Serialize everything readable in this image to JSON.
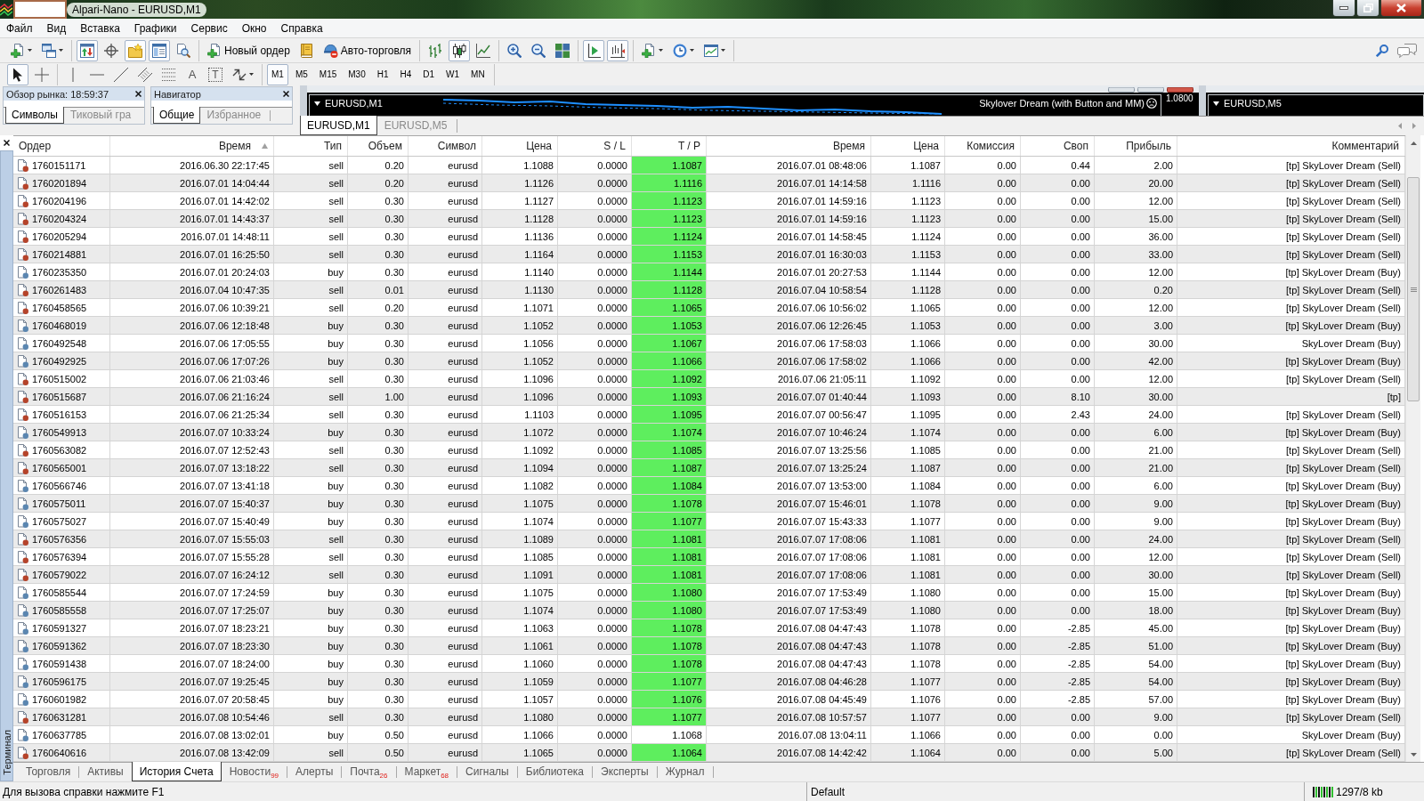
{
  "window": {
    "title": "Alpari-Nano - EURUSD,M1"
  },
  "menu": [
    "Файл",
    "Вид",
    "Вставка",
    "Графики",
    "Сервис",
    "Окно",
    "Справка"
  ],
  "main_toolbar": [
    [
      {
        "pressed": false
      },
      {
        "pressed": false
      }
    ],
    [
      {
        "pressed": true
      },
      {
        "pressed": false
      },
      {
        "pressed": true
      },
      {
        "pressed": true
      },
      {
        "pressed": false
      }
    ],
    [
      {
        "label": "Новый ордер",
        "pressed": false
      },
      {
        "pressed": false
      },
      {
        "label": "Авто-торговля",
        "pressed": false
      }
    ],
    [
      {
        "pressed": false
      },
      {
        "pressed": true
      },
      {
        "pressed": false
      }
    ],
    [
      {
        "pressed": false
      },
      {
        "pressed": false
      },
      {
        "pressed": false
      }
    ],
    [
      {
        "pressed": true
      },
      {
        "pressed": true
      }
    ],
    [
      {
        "pressed": false
      },
      {
        "pressed": false
      },
      {
        "pressed": false
      }
    ]
  ],
  "drawing_toolbar": [
    [
      {
        "pressed": true
      },
      {
        "pressed": false
      }
    ],
    [
      {
        "pressed": false
      },
      {
        "pressed": false
      },
      {
        "pressed": false
      },
      {
        "pressed": false
      },
      {
        "pressed": false
      },
      {
        "label": "A",
        "pressed": false
      },
      {
        "label": "T",
        "pressed": false
      },
      {
        "pressed": false
      }
    ]
  ],
  "timeframes": [
    {
      "label": "M1",
      "selected": true
    },
    {
      "label": "M5",
      "selected": false
    },
    {
      "label": "M15",
      "selected": false
    },
    {
      "label": "M30",
      "selected": false
    },
    {
      "label": "H1",
      "selected": false
    },
    {
      "label": "H4",
      "selected": false
    },
    {
      "label": "D1",
      "selected": false
    },
    {
      "label": "W1",
      "selected": false
    },
    {
      "label": "MN",
      "selected": false
    }
  ],
  "market_watch": {
    "title": "Обзор рынка: 18:59:37",
    "tabs": [
      {
        "label": "Символы",
        "selected": true
      },
      {
        "label": "Тиковый гра",
        "selected": false
      }
    ]
  },
  "navigator": {
    "title": "Навигатор",
    "tabs": [
      {
        "label": "Общие",
        "selected": true
      },
      {
        "label": "Избранное",
        "selected": false
      }
    ]
  },
  "charts": [
    {
      "title": "EURUSD,M1",
      "expert": "Skylover Dream (with Button and MM)",
      "price_label": "1.0800"
    },
    {
      "title": "EURUSD,M5"
    }
  ],
  "chart_tabs": [
    {
      "label": "EURUSD,M1",
      "selected": true
    },
    {
      "label": "EURUSD,M5",
      "selected": false
    }
  ],
  "terminal": {
    "label": "Терминал",
    "columns": [
      {
        "title": "Ордер",
        "sorted": false
      },
      {
        "title": "Время",
        "sorted": true
      },
      {
        "title": "Тип",
        "sorted": false
      },
      {
        "title": "Объем",
        "sorted": false
      },
      {
        "title": "Символ",
        "sorted": false
      },
      {
        "title": "Цена",
        "sorted": false
      },
      {
        "title": "S / L",
        "sorted": false
      },
      {
        "title": "T / P",
        "sorted": false
      },
      {
        "title": "Время",
        "sorted": false
      },
      {
        "title": "Цена",
        "sorted": false
      },
      {
        "title": "Комиссия",
        "sorted": false
      },
      {
        "title": "Своп",
        "sorted": false
      },
      {
        "title": "Прибыль",
        "sorted": false
      },
      {
        "title": "Комментарий",
        "sorted": false
      }
    ],
    "rows": [
      {
        "kind": "sell",
        "tp_hit": true,
        "cells": [
          "1760151171",
          "2016.06.30 22:17:45",
          "sell",
          "0.20",
          "eurusd",
          "1.1088",
          "0.0000",
          "1.1087",
          "2016.07.01 08:48:06",
          "1.1087",
          "0.00",
          "0.44",
          "2.00",
          "[tp] SkyLover Dream (Sell)"
        ]
      },
      {
        "kind": "sell",
        "tp_hit": true,
        "cells": [
          "1760201894",
          "2016.07.01 14:04:44",
          "sell",
          "0.20",
          "eurusd",
          "1.1126",
          "0.0000",
          "1.1116",
          "2016.07.01 14:14:58",
          "1.1116",
          "0.00",
          "0.00",
          "20.00",
          "[tp] SkyLover Dream (Sell)"
        ]
      },
      {
        "kind": "sell",
        "tp_hit": true,
        "cells": [
          "1760204196",
          "2016.07.01 14:42:02",
          "sell",
          "0.30",
          "eurusd",
          "1.1127",
          "0.0000",
          "1.1123",
          "2016.07.01 14:59:16",
          "1.1123",
          "0.00",
          "0.00",
          "12.00",
          "[tp] SkyLover Dream (Sell)"
        ]
      },
      {
        "kind": "sell",
        "tp_hit": true,
        "cells": [
          "1760204324",
          "2016.07.01 14:43:37",
          "sell",
          "0.30",
          "eurusd",
          "1.1128",
          "0.0000",
          "1.1123",
          "2016.07.01 14:59:16",
          "1.1123",
          "0.00",
          "0.00",
          "15.00",
          "[tp] SkyLover Dream (Sell)"
        ]
      },
      {
        "kind": "sell",
        "tp_hit": true,
        "cells": [
          "1760205294",
          "2016.07.01 14:48:11",
          "sell",
          "0.30",
          "eurusd",
          "1.1136",
          "0.0000",
          "1.1124",
          "2016.07.01 14:58:45",
          "1.1124",
          "0.00",
          "0.00",
          "36.00",
          "[tp] SkyLover Dream (Sell)"
        ]
      },
      {
        "kind": "sell",
        "tp_hit": true,
        "cells": [
          "1760214881",
          "2016.07.01 16:25:50",
          "sell",
          "0.30",
          "eurusd",
          "1.1164",
          "0.0000",
          "1.1153",
          "2016.07.01 16:30:03",
          "1.1153",
          "0.00",
          "0.00",
          "33.00",
          "[tp] SkyLover Dream (Sell)"
        ]
      },
      {
        "kind": "buy",
        "tp_hit": true,
        "cells": [
          "1760235350",
          "2016.07.01 20:24:03",
          "buy",
          "0.30",
          "eurusd",
          "1.1140",
          "0.0000",
          "1.1144",
          "2016.07.01 20:27:53",
          "1.1144",
          "0.00",
          "0.00",
          "12.00",
          "[tp] SkyLover Dream (Buy)"
        ]
      },
      {
        "kind": "sell",
        "tp_hit": true,
        "cells": [
          "1760261483",
          "2016.07.04 10:47:35",
          "sell",
          "0.01",
          "eurusd",
          "1.1130",
          "0.0000",
          "1.1128",
          "2016.07.04 10:58:54",
          "1.1128",
          "0.00",
          "0.00",
          "0.20",
          "[tp] SkyLover Dream (Sell)"
        ]
      },
      {
        "kind": "sell",
        "tp_hit": true,
        "cells": [
          "1760458565",
          "2016.07.06 10:39:21",
          "sell",
          "0.20",
          "eurusd",
          "1.1071",
          "0.0000",
          "1.1065",
          "2016.07.06 10:56:02",
          "1.1065",
          "0.00",
          "0.00",
          "12.00",
          "[tp] SkyLover Dream (Sell)"
        ]
      },
      {
        "kind": "buy",
        "tp_hit": true,
        "cells": [
          "1760468019",
          "2016.07.06 12:18:48",
          "buy",
          "0.30",
          "eurusd",
          "1.1052",
          "0.0000",
          "1.1053",
          "2016.07.06 12:26:45",
          "1.1053",
          "0.00",
          "0.00",
          "3.00",
          "[tp] SkyLover Dream (Buy)"
        ]
      },
      {
        "kind": "buy",
        "tp_hit": true,
        "cells": [
          "1760492548",
          "2016.07.06 17:05:55",
          "buy",
          "0.30",
          "eurusd",
          "1.1056",
          "0.0000",
          "1.1067",
          "2016.07.06 17:58:03",
          "1.1066",
          "0.00",
          "0.00",
          "30.00",
          "SkyLover Dream (Buy)"
        ]
      },
      {
        "kind": "buy",
        "tp_hit": true,
        "cells": [
          "1760492925",
          "2016.07.06 17:07:26",
          "buy",
          "0.30",
          "eurusd",
          "1.1052",
          "0.0000",
          "1.1066",
          "2016.07.06 17:58:02",
          "1.1066",
          "0.00",
          "0.00",
          "42.00",
          "[tp] SkyLover Dream (Buy)"
        ]
      },
      {
        "kind": "sell",
        "tp_hit": true,
        "cells": [
          "1760515002",
          "2016.07.06 21:03:46",
          "sell",
          "0.30",
          "eurusd",
          "1.1096",
          "0.0000",
          "1.1092",
          "2016.07.06 21:05:11",
          "1.1092",
          "0.00",
          "0.00",
          "12.00",
          "[tp] SkyLover Dream (Sell)"
        ]
      },
      {
        "kind": "sell",
        "tp_hit": true,
        "cells": [
          "1760515687",
          "2016.07.06 21:16:24",
          "sell",
          "1.00",
          "eurusd",
          "1.1096",
          "0.0000",
          "1.1093",
          "2016.07.07 01:40:44",
          "1.1093",
          "0.00",
          "8.10",
          "30.00",
          "[tp]"
        ]
      },
      {
        "kind": "sell",
        "tp_hit": true,
        "cells": [
          "1760516153",
          "2016.07.06 21:25:34",
          "sell",
          "0.30",
          "eurusd",
          "1.1103",
          "0.0000",
          "1.1095",
          "2016.07.07 00:56:47",
          "1.1095",
          "0.00",
          "2.43",
          "24.00",
          "[tp] SkyLover Dream (Sell)"
        ]
      },
      {
        "kind": "buy",
        "tp_hit": true,
        "cells": [
          "1760549913",
          "2016.07.07 10:33:24",
          "buy",
          "0.30",
          "eurusd",
          "1.1072",
          "0.0000",
          "1.1074",
          "2016.07.07 10:46:24",
          "1.1074",
          "0.00",
          "0.00",
          "6.00",
          "[tp] SkyLover Dream (Buy)"
        ]
      },
      {
        "kind": "sell",
        "tp_hit": true,
        "cells": [
          "1760563082",
          "2016.07.07 12:52:43",
          "sell",
          "0.30",
          "eurusd",
          "1.1092",
          "0.0000",
          "1.1085",
          "2016.07.07 13:25:56",
          "1.1085",
          "0.00",
          "0.00",
          "21.00",
          "[tp] SkyLover Dream (Sell)"
        ]
      },
      {
        "kind": "sell",
        "tp_hit": true,
        "cells": [
          "1760565001",
          "2016.07.07 13:18:22",
          "sell",
          "0.30",
          "eurusd",
          "1.1094",
          "0.0000",
          "1.1087",
          "2016.07.07 13:25:24",
          "1.1087",
          "0.00",
          "0.00",
          "21.00",
          "[tp] SkyLover Dream (Sell)"
        ]
      },
      {
        "kind": "buy",
        "tp_hit": true,
        "cells": [
          "1760566746",
          "2016.07.07 13:41:18",
          "buy",
          "0.30",
          "eurusd",
          "1.1082",
          "0.0000",
          "1.1084",
          "2016.07.07 13:53:00",
          "1.1084",
          "0.00",
          "0.00",
          "6.00",
          "[tp] SkyLover Dream (Buy)"
        ]
      },
      {
        "kind": "buy",
        "tp_hit": true,
        "cells": [
          "1760575011",
          "2016.07.07 15:40:37",
          "buy",
          "0.30",
          "eurusd",
          "1.1075",
          "0.0000",
          "1.1078",
          "2016.07.07 15:46:01",
          "1.1078",
          "0.00",
          "0.00",
          "9.00",
          "[tp] SkyLover Dream (Buy)"
        ]
      },
      {
        "kind": "buy",
        "tp_hit": true,
        "cells": [
          "1760575027",
          "2016.07.07 15:40:49",
          "buy",
          "0.30",
          "eurusd",
          "1.1074",
          "0.0000",
          "1.1077",
          "2016.07.07 15:43:33",
          "1.1077",
          "0.00",
          "0.00",
          "9.00",
          "[tp] SkyLover Dream (Buy)"
        ]
      },
      {
        "kind": "sell",
        "tp_hit": true,
        "cells": [
          "1760576356",
          "2016.07.07 15:55:03",
          "sell",
          "0.30",
          "eurusd",
          "1.1089",
          "0.0000",
          "1.1081",
          "2016.07.07 17:08:06",
          "1.1081",
          "0.00",
          "0.00",
          "24.00",
          "[tp] SkyLover Dream (Sell)"
        ]
      },
      {
        "kind": "sell",
        "tp_hit": true,
        "cells": [
          "1760576394",
          "2016.07.07 15:55:28",
          "sell",
          "0.30",
          "eurusd",
          "1.1085",
          "0.0000",
          "1.1081",
          "2016.07.07 17:08:06",
          "1.1081",
          "0.00",
          "0.00",
          "12.00",
          "[tp] SkyLover Dream (Sell)"
        ]
      },
      {
        "kind": "sell",
        "tp_hit": true,
        "cells": [
          "1760579022",
          "2016.07.07 16:24:12",
          "sell",
          "0.30",
          "eurusd",
          "1.1091",
          "0.0000",
          "1.1081",
          "2016.07.07 17:08:06",
          "1.1081",
          "0.00",
          "0.00",
          "30.00",
          "[tp] SkyLover Dream (Sell)"
        ]
      },
      {
        "kind": "buy",
        "tp_hit": true,
        "cells": [
          "1760585544",
          "2016.07.07 17:24:59",
          "buy",
          "0.30",
          "eurusd",
          "1.1075",
          "0.0000",
          "1.1080",
          "2016.07.07 17:53:49",
          "1.1080",
          "0.00",
          "0.00",
          "15.00",
          "[tp] SkyLover Dream (Buy)"
        ]
      },
      {
        "kind": "buy",
        "tp_hit": true,
        "cells": [
          "1760585558",
          "2016.07.07 17:25:07",
          "buy",
          "0.30",
          "eurusd",
          "1.1074",
          "0.0000",
          "1.1080",
          "2016.07.07 17:53:49",
          "1.1080",
          "0.00",
          "0.00",
          "18.00",
          "[tp] SkyLover Dream (Buy)"
        ]
      },
      {
        "kind": "buy",
        "tp_hit": true,
        "cells": [
          "1760591327",
          "2016.07.07 18:23:21",
          "buy",
          "0.30",
          "eurusd",
          "1.1063",
          "0.0000",
          "1.1078",
          "2016.07.08 04:47:43",
          "1.1078",
          "0.00",
          "-2.85",
          "45.00",
          "[tp] SkyLover Dream (Buy)"
        ]
      },
      {
        "kind": "buy",
        "tp_hit": true,
        "cells": [
          "1760591362",
          "2016.07.07 18:23:30",
          "buy",
          "0.30",
          "eurusd",
          "1.1061",
          "0.0000",
          "1.1078",
          "2016.07.08 04:47:43",
          "1.1078",
          "0.00",
          "-2.85",
          "51.00",
          "[tp] SkyLover Dream (Buy)"
        ]
      },
      {
        "kind": "buy",
        "tp_hit": true,
        "cells": [
          "1760591438",
          "2016.07.07 18:24:00",
          "buy",
          "0.30",
          "eurusd",
          "1.1060",
          "0.0000",
          "1.1078",
          "2016.07.08 04:47:43",
          "1.1078",
          "0.00",
          "-2.85",
          "54.00",
          "[tp] SkyLover Dream (Buy)"
        ]
      },
      {
        "kind": "buy",
        "tp_hit": true,
        "cells": [
          "1760596175",
          "2016.07.07 19:25:45",
          "buy",
          "0.30",
          "eurusd",
          "1.1059",
          "0.0000",
          "1.1077",
          "2016.07.08 04:46:28",
          "1.1077",
          "0.00",
          "-2.85",
          "54.00",
          "[tp] SkyLover Dream (Buy)"
        ]
      },
      {
        "kind": "buy",
        "tp_hit": true,
        "cells": [
          "1760601982",
          "2016.07.07 20:58:45",
          "buy",
          "0.30",
          "eurusd",
          "1.1057",
          "0.0000",
          "1.1076",
          "2016.07.08 04:45:49",
          "1.1076",
          "0.00",
          "-2.85",
          "57.00",
          "[tp] SkyLover Dream (Buy)"
        ]
      },
      {
        "kind": "sell",
        "tp_hit": true,
        "cells": [
          "1760631281",
          "2016.07.08 10:54:46",
          "sell",
          "0.30",
          "eurusd",
          "1.1080",
          "0.0000",
          "1.1077",
          "2016.07.08 10:57:57",
          "1.1077",
          "0.00",
          "0.00",
          "9.00",
          "[tp] SkyLover Dream (Sell)"
        ]
      },
      {
        "kind": "buy",
        "tp_hit": false,
        "cells": [
          "1760637785",
          "2016.07.08 13:02:01",
          "buy",
          "0.50",
          "eurusd",
          "1.1066",
          "0.0000",
          "1.1068",
          "2016.07.08 13:04:11",
          "1.1066",
          "0.00",
          "0.00",
          "0.00",
          "SkyLover Dream (Buy)"
        ]
      },
      {
        "kind": "sell",
        "tp_hit": true,
        "cells": [
          "1760640616",
          "2016.07.08 13:42:09",
          "sell",
          "0.50",
          "eurusd",
          "1.1065",
          "0.0000",
          "1.1064",
          "2016.07.08 14:42:42",
          "1.1064",
          "0.00",
          "0.00",
          "5.00",
          "[tp] SkyLover Dream (Sell)"
        ]
      }
    ],
    "tabs": [
      {
        "label": "Торговля",
        "selected": false
      },
      {
        "label": "Активы",
        "selected": false
      },
      {
        "label": "История Счета",
        "selected": true
      },
      {
        "label": "Новости$_{99}$",
        "selected": false
      },
      {
        "label": "Алерты",
        "selected": false
      },
      {
        "label": "Почта$_{26}$",
        "selected": false
      },
      {
        "label": "Маркет$_{68}$",
        "selected": false
      },
      {
        "label": "Сигналы",
        "selected": false
      },
      {
        "label": "Библиотека",
        "selected": false
      },
      {
        "label": "Эксперты",
        "selected": false
      },
      {
        "label": "Журнал",
        "selected": false
      }
    ]
  },
  "status_bar": {
    "help": "Для вызова справки нажмите F1",
    "profile": "Default",
    "traffic": "1297/8 kb"
  }
}
